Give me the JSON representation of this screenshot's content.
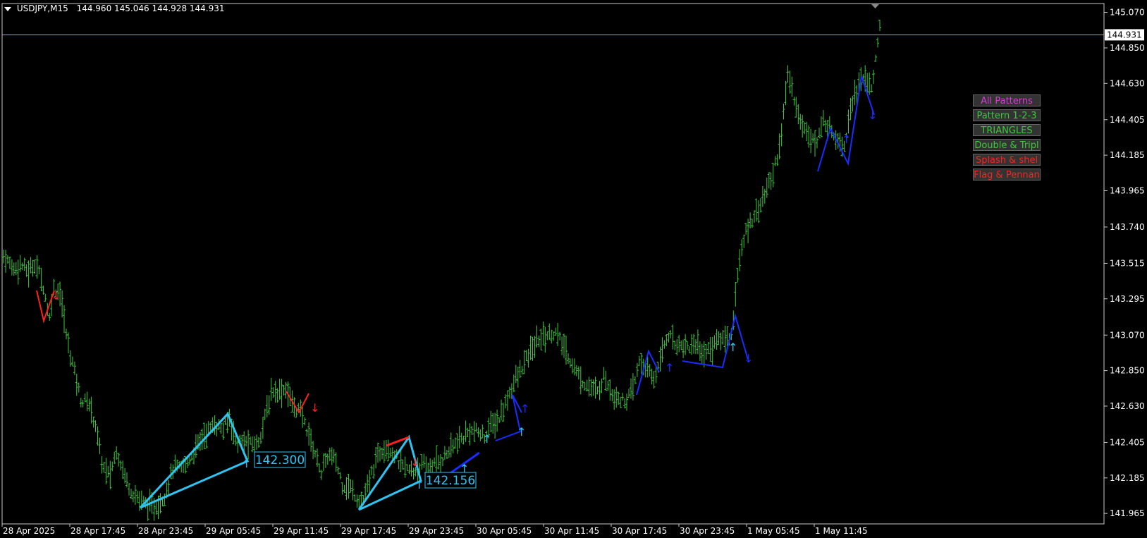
{
  "header": {
    "symbol": "USDJPY,M15",
    "ohlc": "144.960 145.046 144.928 144.931"
  },
  "panel": {
    "buttons": [
      {
        "label": "All Patterns",
        "color": "#d63cd6"
      },
      {
        "label": "Pattern 1-2-3",
        "color": "#3cc83c"
      },
      {
        "label": "TRIANGLES",
        "color": "#3cc83c"
      },
      {
        "label": "Double & Tripl",
        "color": "#3cc83c"
      },
      {
        "label": "Splash & shel",
        "color": "#ff2020"
      },
      {
        "label": "Flag & Pennan",
        "color": "#ff2020"
      }
    ]
  },
  "chart_data": {
    "type": "bar",
    "symbol": "USDJPY",
    "timeframe": "M15",
    "x_ticks": [
      "28 Apr 2025",
      "28 Apr 17:45",
      "28 Apr 23:45",
      "29 Apr 05:45",
      "29 Apr 11:45",
      "29 Apr 17:45",
      "29 Apr 23:45",
      "30 Apr 05:45",
      "30 Apr 11:45",
      "30 Apr 17:45",
      "30 Apr 23:45",
      "1 May 05:45",
      "1 May 11:45"
    ],
    "y_ticks": [
      141.965,
      142.185,
      142.405,
      142.63,
      142.85,
      143.07,
      143.295,
      143.515,
      143.74,
      143.965,
      144.185,
      144.405,
      144.63,
      144.85,
      145.07
    ],
    "y_tick_labels": [
      "141.965",
      "142.185",
      "142.405",
      "142.630",
      "142.850",
      "143.070",
      "143.295",
      "143.515",
      "143.740",
      "143.965",
      "144.185",
      "144.405",
      "144.630",
      "144.850",
      "145.070"
    ],
    "ylim": [
      141.9,
      145.125
    ],
    "current_price": 144.931,
    "current_price_label": "144.931",
    "bar_color": "#3cc83c",
    "price_path": [
      [
        0,
        143.56
      ],
      [
        3,
        143.48
      ],
      [
        5,
        143.51
      ],
      [
        7,
        143.46
      ],
      [
        9,
        143.52
      ],
      [
        11,
        143.4
      ],
      [
        13,
        143.17
      ],
      [
        14,
        143.36
      ],
      [
        16,
        143.34
      ],
      [
        18,
        143.04
      ],
      [
        20,
        142.86
      ],
      [
        22,
        142.66
      ],
      [
        24,
        142.66
      ],
      [
        26,
        142.52
      ],
      [
        28,
        142.26
      ],
      [
        30,
        142.19
      ],
      [
        32,
        142.36
      ],
      [
        34,
        142.22
      ],
      [
        36,
        142.11
      ],
      [
        38,
        142.06
      ],
      [
        40,
        142.03
      ],
      [
        42,
        142.0
      ],
      [
        44,
        142.02
      ],
      [
        46,
        142.1
      ],
      [
        48,
        142.25
      ],
      [
        50,
        142.24
      ],
      [
        52,
        142.28
      ],
      [
        54,
        142.35
      ],
      [
        56,
        142.43
      ],
      [
        58,
        142.48
      ],
      [
        60,
        142.52
      ],
      [
        62,
        142.48
      ],
      [
        64,
        142.56
      ],
      [
        66,
        142.4
      ],
      [
        68,
        142.41
      ],
      [
        70,
        142.39
      ],
      [
        72,
        142.4
      ],
      [
        74,
        142.56
      ],
      [
        76,
        142.73
      ],
      [
        78,
        142.72
      ],
      [
        80,
        142.74
      ],
      [
        82,
        142.63
      ],
      [
        84,
        142.6
      ],
      [
        86,
        142.48
      ],
      [
        88,
        142.35
      ],
      [
        90,
        142.22
      ],
      [
        92,
        142.33
      ],
      [
        94,
        142.29
      ],
      [
        96,
        142.14
      ],
      [
        98,
        142.13
      ],
      [
        100,
        142.06
      ],
      [
        102,
        142.05
      ],
      [
        104,
        142.2
      ],
      [
        106,
        142.33
      ],
      [
        108,
        142.39
      ],
      [
        110,
        142.35
      ],
      [
        112,
        142.28
      ],
      [
        114,
        142.24
      ],
      [
        116,
        142.22
      ],
      [
        118,
        142.27
      ],
      [
        120,
        142.24
      ],
      [
        122,
        142.27
      ],
      [
        124,
        142.3
      ],
      [
        126,
        142.35
      ],
      [
        128,
        142.4
      ],
      [
        130,
        142.43
      ],
      [
        132,
        142.48
      ],
      [
        134,
        142.47
      ],
      [
        136,
        142.44
      ],
      [
        138,
        142.51
      ],
      [
        140,
        142.54
      ],
      [
        142,
        142.64
      ],
      [
        144,
        142.76
      ],
      [
        146,
        142.83
      ],
      [
        148,
        142.92
      ],
      [
        150,
        143.0
      ],
      [
        152,
        143.06
      ],
      [
        154,
        143.07
      ],
      [
        156,
        143.09
      ],
      [
        158,
        143.02
      ],
      [
        160,
        142.93
      ],
      [
        162,
        142.85
      ],
      [
        164,
        142.78
      ],
      [
        166,
        142.75
      ],
      [
        168,
        142.71
      ],
      [
        170,
        142.82
      ],
      [
        172,
        142.72
      ],
      [
        174,
        142.68
      ],
      [
        176,
        142.66
      ],
      [
        178,
        142.72
      ],
      [
        180,
        142.91
      ],
      [
        182,
        142.86
      ],
      [
        184,
        142.79
      ],
      [
        186,
        142.94
      ],
      [
        188,
        143.08
      ],
      [
        190,
        143.02
      ],
      [
        192,
        143.01
      ],
      [
        194,
        143.0
      ],
      [
        196,
        143.02
      ],
      [
        198,
        142.96
      ],
      [
        200,
        142.98
      ],
      [
        202,
        143.04
      ],
      [
        204,
        143.05
      ],
      [
        206,
        143.07
      ],
      [
        208,
        143.5
      ],
      [
        210,
        143.7
      ],
      [
        212,
        143.8
      ],
      [
        214,
        143.87
      ],
      [
        216,
        143.97
      ],
      [
        218,
        144.09
      ],
      [
        220,
        144.28
      ],
      [
        222,
        144.69
      ],
      [
        224,
        144.52
      ],
      [
        226,
        144.36
      ],
      [
        228,
        144.33
      ],
      [
        230,
        144.24
      ],
      [
        232,
        144.4
      ],
      [
        234,
        144.35
      ],
      [
        236,
        144.29
      ],
      [
        238,
        144.25
      ],
      [
        240,
        144.52
      ],
      [
        242,
        144.62
      ],
      [
        244,
        144.67
      ],
      [
        246,
        144.6
      ],
      [
        248,
        144.99
      ]
    ]
  }
}
